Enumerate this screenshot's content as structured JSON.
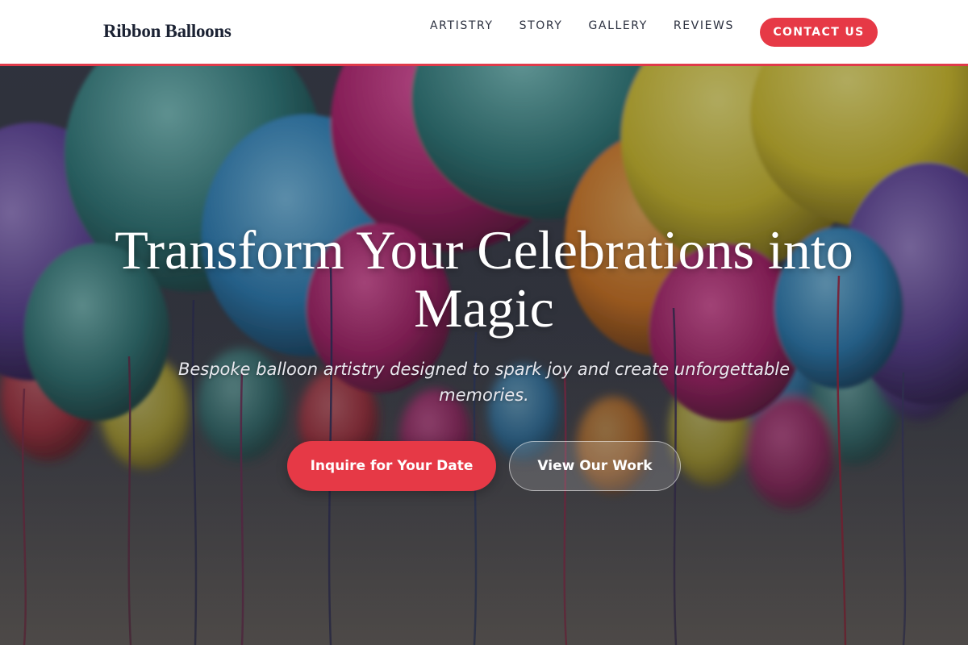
{
  "brand": {
    "name": "Ribbon Balloons"
  },
  "nav": {
    "links": [
      {
        "label": "ARTISTRY"
      },
      {
        "label": "STORY"
      },
      {
        "label": "GALLERY"
      },
      {
        "label": "REVIEWS"
      }
    ],
    "contact_label": "CONTACT US"
  },
  "hero": {
    "title": "Transform Your Celebrations into Magic",
    "subtitle": "Bespoke balloon artistry designed to spark joy and create unforgettable memories.",
    "primary_cta": "Inquire for Your Date",
    "secondary_cta": "View Our Work",
    "background_image": "colorful-balloons-photo"
  },
  "colors": {
    "accent": "#e63946",
    "brand_text": "#1b2233",
    "nav_border": "#e03a4a"
  }
}
